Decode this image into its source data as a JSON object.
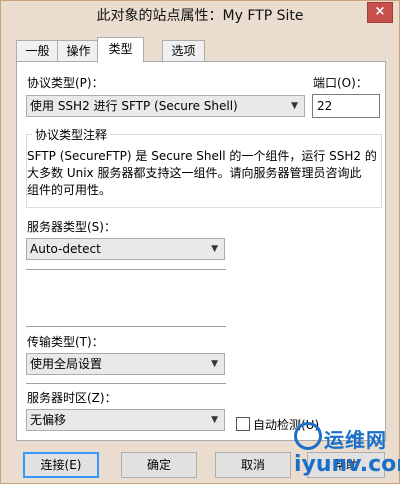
{
  "window": {
    "title": "此对象的站点属性：My FTP Site",
    "close_label": "×"
  },
  "tabs": [
    {
      "label": "一般",
      "active": false
    },
    {
      "label": "操作",
      "active": false
    },
    {
      "label": "类型",
      "active": true
    },
    {
      "label": "选项",
      "active": false
    }
  ],
  "protocol": {
    "label": "协议类型(P)：",
    "value": "使用 SSH2 进行 SFTP (Secure Shell)",
    "port_label": "端口(O)：",
    "port_value": "22"
  },
  "notes": {
    "title": "协议类型注释",
    "lines": [
      "SFTP (SecureFTP) 是 Secure Shell 的一个组件，运行 SSH2 的",
      "大多数 Unix 服务器都支持这一组件。请向服务器管理员咨询此",
      "组件的可用性。"
    ]
  },
  "server_type": {
    "label": "服务器类型(S)：",
    "value": "Auto-detect"
  },
  "transfer_type": {
    "label": "传输类型(T)：",
    "value": "使用全局设置"
  },
  "timezone": {
    "label": "服务器时区(Z)：",
    "value": "无偏移",
    "autodetect_label": "自动检测(U)",
    "autodetect_checked": false
  },
  "buttons": {
    "connect": "连接(E)",
    "ok": "确定",
    "cancel": "取消",
    "help": "帮助"
  },
  "watermark": {
    "top": "运维网",
    "bottom": "iyunv.com"
  },
  "colors": {
    "titlebar": "#eaddcf",
    "close": "#c7514a",
    "accent": "#3399ff",
    "watermark": "#1a70c8"
  }
}
